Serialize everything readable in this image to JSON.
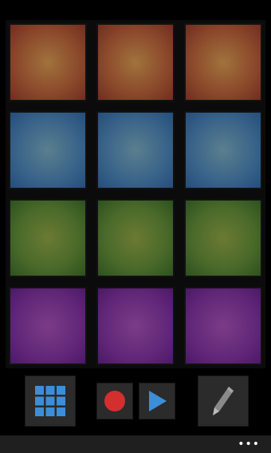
{
  "pads": [
    {
      "color": "orange"
    },
    {
      "color": "orange"
    },
    {
      "color": "orange"
    },
    {
      "color": "blue"
    },
    {
      "color": "blue"
    },
    {
      "color": "blue"
    },
    {
      "color": "green"
    },
    {
      "color": "green"
    },
    {
      "color": "green"
    },
    {
      "color": "purple"
    },
    {
      "color": "purple"
    },
    {
      "color": "purple"
    }
  ],
  "toolbar": {
    "grid_icon": "grid-icon",
    "record_icon": "record-icon",
    "play_icon": "play-icon",
    "edit_icon": "pencil-icon",
    "accent_blue": "#3b8fd9",
    "record_red": "#d32f2f"
  },
  "appbar": {
    "more_label": "•••"
  }
}
